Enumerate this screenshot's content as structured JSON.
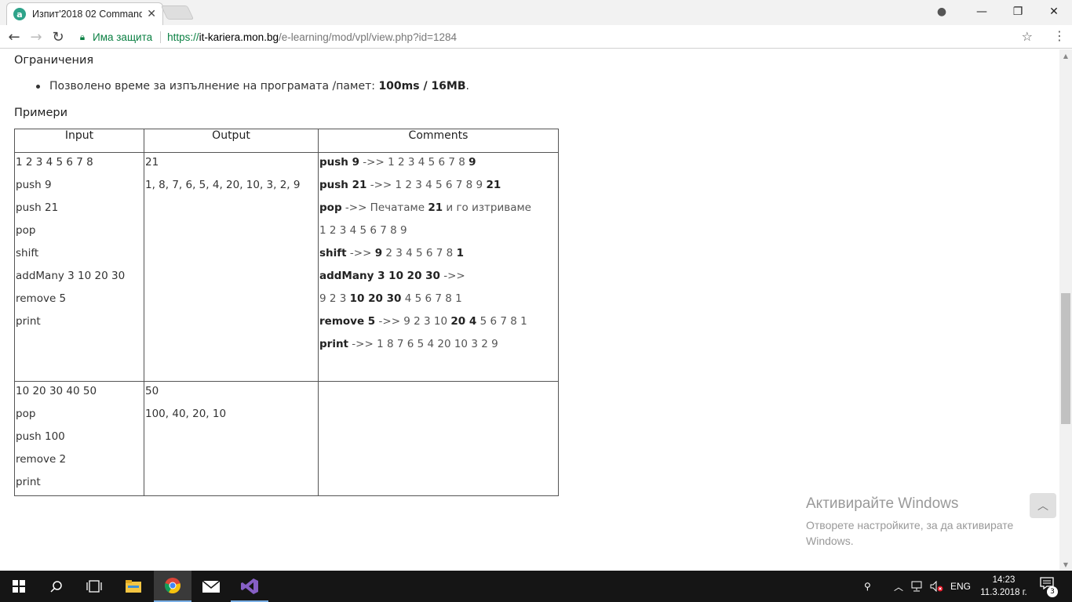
{
  "browser": {
    "tab_title": "Изпит'2018 02 Command",
    "tab_close": "✕",
    "secure_label": "Има защита",
    "url_scheme": "https://",
    "url_host": "it-kariera.mon.bg",
    "url_path": "/e-learning/mod/vpl/view.php?id=1284"
  },
  "page": {
    "constraints_heading": "Ограничения",
    "constraint_text": "Позволено време за изпълнение на програмата /памет: ",
    "constraint_value": "100ms / 16MB",
    "constraint_end": ".",
    "examples_heading": "Примери",
    "table": {
      "headers": [
        "Input",
        "Output",
        "Comments"
      ],
      "row1": {
        "input": [
          "1 2 3 4 5 6 7 8",
          "push 9",
          "push 21",
          "pop",
          "shift",
          "addMany 3 10 20 30",
          "remove 5",
          "print"
        ],
        "output": [
          "21",
          "1, 8, 7, 6, 5, 4, 20, 10, 3, 2, 9"
        ],
        "comments": [
          [
            {
              "t": "push 9",
              "b": true
            },
            {
              "t": " ->> 1 2 3 4 5 6 7 8 ",
              "b": false
            },
            {
              "t": "9",
              "b": true
            }
          ],
          [
            {
              "t": "push 21",
              "b": true
            },
            {
              "t": " ->> 1 2 3 4 5 6 7 8 9 ",
              "b": false
            },
            {
              "t": "21",
              "b": true
            }
          ],
          [
            {
              "t": "pop",
              "b": true
            },
            {
              "t": " ->> Печатаме ",
              "b": false
            },
            {
              "t": "21",
              "b": true
            },
            {
              "t": " и го изтриваме",
              "b": false
            }
          ],
          [
            {
              "t": "1 2 3 4 5 6 7 8 9",
              "b": false
            }
          ],
          [
            {
              "t": "shift",
              "b": true
            },
            {
              "t": " ->> ",
              "b": false
            },
            {
              "t": "9",
              "b": true
            },
            {
              "t": " 2 3 4 5 6 7 8 ",
              "b": false
            },
            {
              "t": "1",
              "b": true
            }
          ],
          [
            {
              "t": "addMany 3 10 20 30",
              "b": true
            },
            {
              "t": " ->>",
              "b": false
            }
          ],
          [
            {
              "t": "9 2 3 ",
              "b": false
            },
            {
              "t": "10 20 30",
              "b": true
            },
            {
              "t": " 4 5 6 7 8 1",
              "b": false
            }
          ],
          [
            {
              "t": "remove 5",
              "b": true
            },
            {
              "t": " ->> 9 2 3 10 ",
              "b": false
            },
            {
              "t": "20 4",
              "b": true
            },
            {
              "t": " 5 6 7 8 1",
              "b": false
            }
          ],
          [
            {
              "t": "print",
              "b": true
            },
            {
              "t": " ->> 1 8 7 6 5 4 20 10 3 2 9",
              "b": false
            }
          ]
        ]
      },
      "row2": {
        "input": [
          "10 20 30 40 50",
          "pop",
          "push 100",
          "remove 2",
          "print"
        ],
        "output": [
          "50",
          "100, 40, 20, 10"
        ],
        "comments": []
      }
    },
    "activate_title": "Активирайте Windows",
    "activate_sub": "Отворете настройките, за да активирате Windows."
  },
  "taskbar": {
    "lang": "ENG",
    "time": "14:23",
    "date": "11.3.2018 г.",
    "notif_count": "3"
  }
}
